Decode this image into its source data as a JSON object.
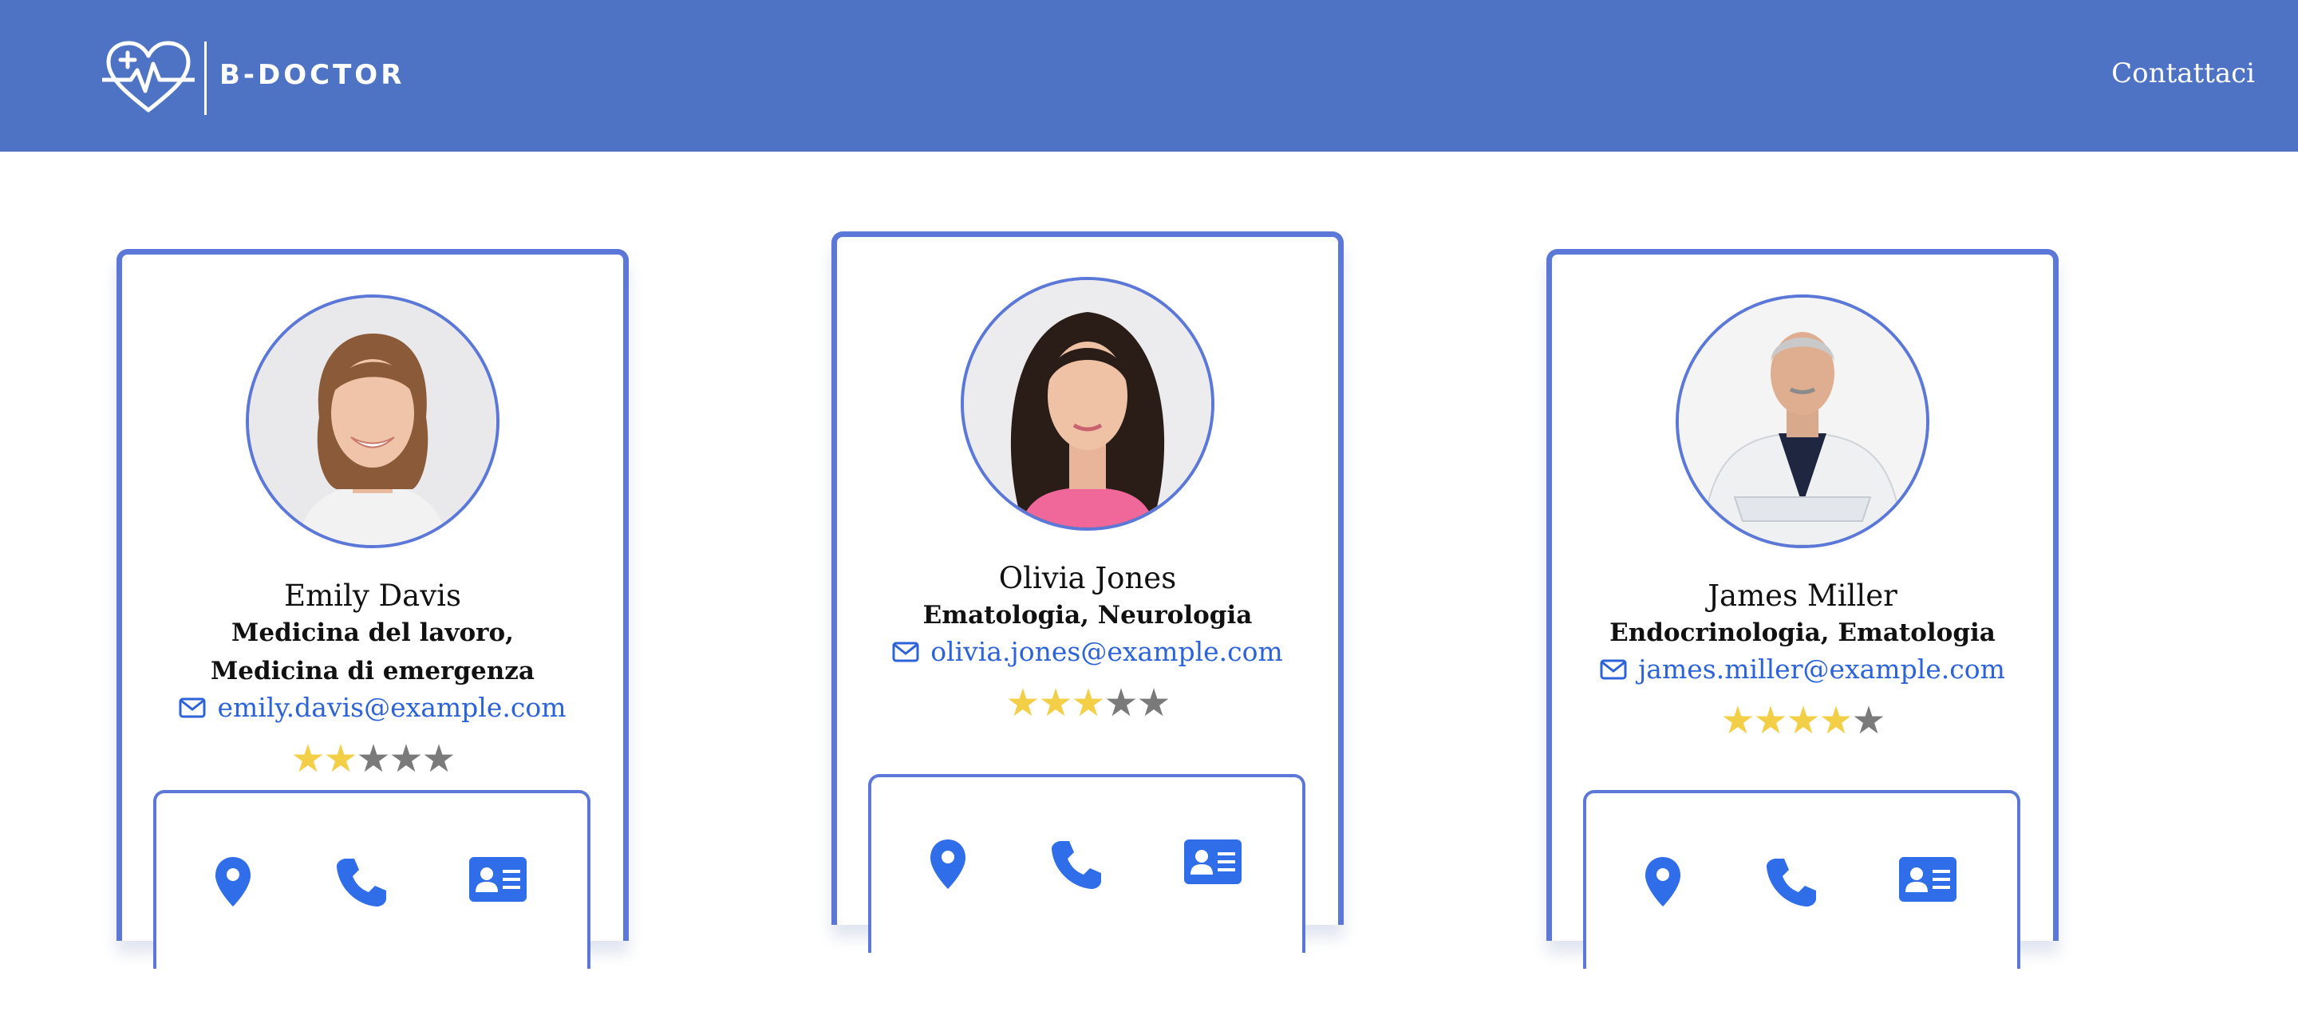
{
  "navbar": {
    "brand": "B-DOCTOR",
    "contact_label": "Contattaci"
  },
  "doctors": [
    {
      "name": "Emily Davis",
      "specialties": "Medicina del lavoro, Medicina di emergenza",
      "email": "emily.davis@example.com",
      "rating": 2,
      "stars_on": "★★",
      "stars_off": "★★★"
    },
    {
      "name": "Olivia Jones",
      "specialties": "Ematologia, Neurologia",
      "email": "olivia.jones@example.com",
      "rating": 3,
      "stars_on": "★★★",
      "stars_off": "★★"
    },
    {
      "name": "James Miller",
      "specialties": "Endocrinologia, Ematologia",
      "email": "james.miller@example.com",
      "rating": 4,
      "stars_on": "★★★★",
      "stars_off": "★"
    }
  ],
  "icons": {
    "location": "location-pin-icon",
    "phone": "phone-icon",
    "contact_card": "contact-card-icon",
    "mail": "envelope-icon"
  },
  "colors": {
    "navbar": "#4f73c4",
    "card_border": "#5b78d9",
    "link": "#2d63d9",
    "star_on": "#f3cf47",
    "star_off": "#7a7a7a",
    "icon": "#2f6ee8"
  }
}
